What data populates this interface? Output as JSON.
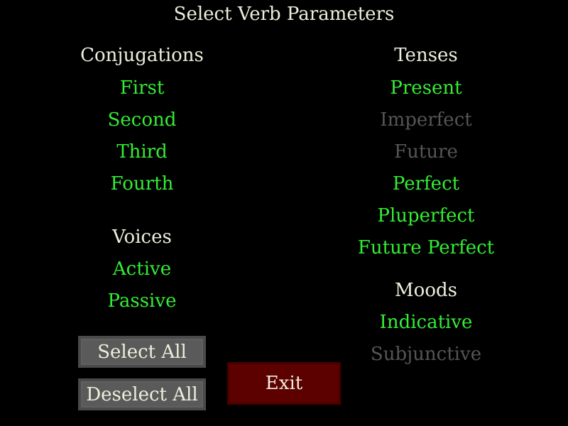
{
  "title": "Select Verb Parameters",
  "colors": {
    "selected": "#33ee33",
    "unselected": "#555555",
    "heading": "#eeeedd"
  },
  "conjugations": {
    "heading": "Conjugations",
    "items": [
      {
        "label": "First",
        "selected": true
      },
      {
        "label": "Second",
        "selected": true
      },
      {
        "label": "Third",
        "selected": true
      },
      {
        "label": "Fourth",
        "selected": true
      }
    ]
  },
  "voices": {
    "heading": "Voices",
    "items": [
      {
        "label": "Active",
        "selected": true
      },
      {
        "label": "Passive",
        "selected": true
      }
    ]
  },
  "tenses": {
    "heading": "Tenses",
    "items": [
      {
        "label": "Present",
        "selected": true
      },
      {
        "label": "Imperfect",
        "selected": false
      },
      {
        "label": "Future",
        "selected": false
      },
      {
        "label": "Perfect",
        "selected": true
      },
      {
        "label": "Pluperfect",
        "selected": true
      },
      {
        "label": "Future Perfect",
        "selected": true
      }
    ]
  },
  "moods": {
    "heading": "Moods",
    "items": [
      {
        "label": "Indicative",
        "selected": true
      },
      {
        "label": "Subjunctive",
        "selected": false
      }
    ]
  },
  "buttons": {
    "select_all": "Select All",
    "deselect_all": "Deselect All",
    "exit": "Exit"
  }
}
